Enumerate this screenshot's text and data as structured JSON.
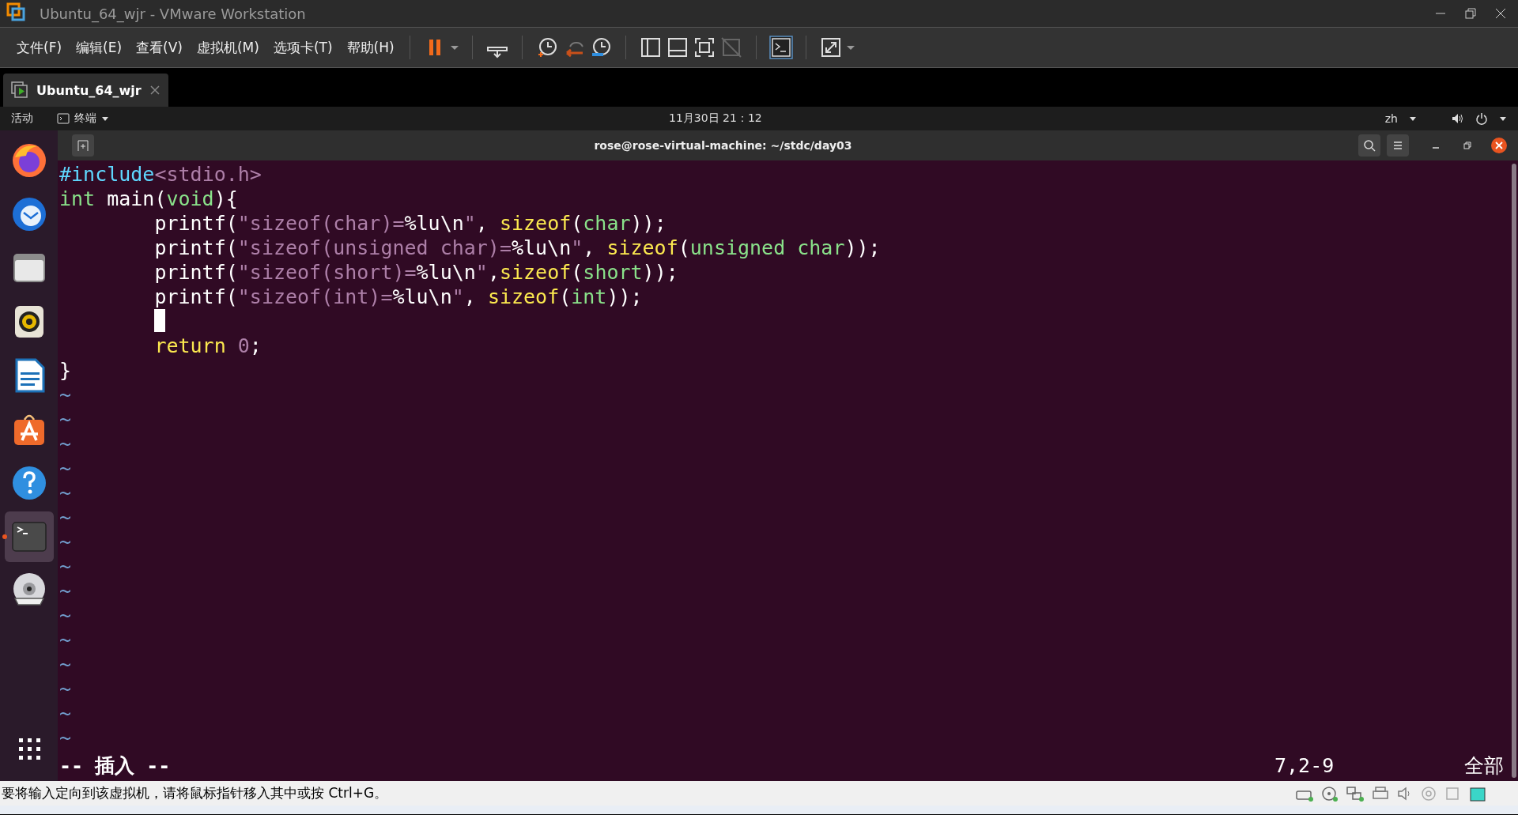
{
  "window": {
    "title": "Ubuntu_64_wjr - VMware Workstation"
  },
  "menu": [
    "文件(F)",
    "编辑(E)",
    "查看(V)",
    "虚拟机(M)",
    "选项卡(T)",
    "帮助(H)"
  ],
  "tabs": [
    {
      "label": "Ubuntu_64_wjr",
      "selected": true
    }
  ],
  "gnome_bar": {
    "activities": "活动",
    "app": "终端",
    "clock": "11月30日  21：12",
    "input": "zh"
  },
  "dock": [
    {
      "kind": "firefox",
      "selected": false,
      "running": false
    },
    {
      "kind": "mail",
      "selected": false,
      "running": false
    },
    {
      "kind": "files",
      "selected": false,
      "running": false
    },
    {
      "kind": "music",
      "selected": false,
      "running": false
    },
    {
      "kind": "writer",
      "selected": false,
      "running": false
    },
    {
      "kind": "store",
      "selected": false,
      "running": false
    },
    {
      "kind": "help",
      "selected": false,
      "running": false
    },
    {
      "kind": "terminal",
      "selected": true,
      "running": true
    },
    {
      "kind": "disc",
      "selected": false,
      "running": false
    }
  ],
  "terminal": {
    "title": "rose@rose-virtual-machine: ~/stdc/day03",
    "lines": [
      [
        {
          "kind": "preproc",
          "text": "#include"
        },
        {
          "kind": "string",
          "text": "<stdio.h>"
        }
      ],
      [
        {
          "kind": "type",
          "text": "int"
        },
        {
          "kind": "plain",
          "text": " main("
        },
        {
          "kind": "type",
          "text": "void"
        },
        {
          "kind": "plain",
          "text": "){"
        }
      ],
      [
        {
          "kind": "plain",
          "text": "        printf("
        },
        {
          "kind": "string",
          "text": "\"sizeof(char)="
        },
        {
          "kind": "plain",
          "text": "%lu\\n"
        },
        {
          "kind": "string",
          "text": "\""
        },
        {
          "kind": "plain",
          "text": ", "
        },
        {
          "kind": "keyword",
          "text": "sizeof"
        },
        {
          "kind": "plain",
          "text": "("
        },
        {
          "kind": "type",
          "text": "char"
        },
        {
          "kind": "plain",
          "text": "));"
        }
      ],
      [
        {
          "kind": "plain",
          "text": "        printf("
        },
        {
          "kind": "string",
          "text": "\"sizeof(unsigned char)="
        },
        {
          "kind": "plain",
          "text": "%lu\\n"
        },
        {
          "kind": "string",
          "text": "\""
        },
        {
          "kind": "plain",
          "text": ", "
        },
        {
          "kind": "keyword",
          "text": "sizeof"
        },
        {
          "kind": "plain",
          "text": "("
        },
        {
          "kind": "type",
          "text": "unsigned char"
        },
        {
          "kind": "plain",
          "text": "));"
        }
      ],
      [
        {
          "kind": "plain",
          "text": "        printf("
        },
        {
          "kind": "string",
          "text": "\"sizeof(short)="
        },
        {
          "kind": "plain",
          "text": "%lu\\n"
        },
        {
          "kind": "string",
          "text": "\""
        },
        {
          "kind": "plain",
          "text": ","
        },
        {
          "kind": "keyword",
          "text": "sizeof"
        },
        {
          "kind": "plain",
          "text": "("
        },
        {
          "kind": "type",
          "text": "short"
        },
        {
          "kind": "plain",
          "text": "));"
        }
      ],
      [
        {
          "kind": "plain",
          "text": "        printf("
        },
        {
          "kind": "string",
          "text": "\"sizeof(int)="
        },
        {
          "kind": "plain",
          "text": "%lu\\n"
        },
        {
          "kind": "string",
          "text": "\""
        },
        {
          "kind": "plain",
          "text": ", "
        },
        {
          "kind": "keyword",
          "text": "sizeof"
        },
        {
          "kind": "plain",
          "text": "("
        },
        {
          "kind": "type",
          "text": "int"
        },
        {
          "kind": "plain",
          "text": "));"
        }
      ],
      [
        {
          "kind": "cursor"
        }
      ],
      [
        {
          "kind": "keyword",
          "text": "        return"
        },
        {
          "kind": "string",
          "text": " 0"
        },
        {
          "kind": "plain",
          "text": ";"
        }
      ],
      [
        {
          "kind": "plain",
          "text": "}"
        }
      ]
    ],
    "tildes": [
      "~",
      "~",
      "~",
      "~",
      "~",
      "~",
      "~",
      "~",
      "~",
      "~",
      "~",
      "~",
      "~",
      "~",
      "~"
    ],
    "mode": "-- 插入 --",
    "position": "7,2-9",
    "scroll": "全部"
  },
  "status_bar": {
    "message": "要将输入定向到该虚拟机，请将鼠标指针移入其中或按 Ctrl+G。"
  }
}
